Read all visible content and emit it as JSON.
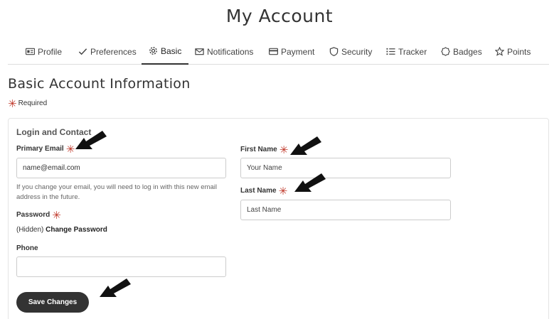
{
  "page": {
    "title": "My Account"
  },
  "tabs": [
    {
      "label": "Profile",
      "icon": "id-card-icon",
      "active": false
    },
    {
      "label": "Preferences",
      "icon": "checkmark-icon",
      "active": false
    },
    {
      "label": "Basic",
      "icon": "gear-icon",
      "active": true
    },
    {
      "label": "Notifications",
      "icon": "envelope-icon",
      "active": false
    },
    {
      "label": "Payment",
      "icon": "credit-card-icon",
      "active": false
    },
    {
      "label": "Security",
      "icon": "shield-icon",
      "active": false
    },
    {
      "label": "Tracker",
      "icon": "list-icon",
      "active": false
    },
    {
      "label": "Badges",
      "icon": "badge-icon",
      "active": false
    },
    {
      "label": "Points",
      "icon": "star-icon",
      "active": false
    }
  ],
  "section": {
    "title": "Basic Account Information",
    "required_note": "Required",
    "required_symbol": "✳"
  },
  "card": {
    "title": "Login and Contact",
    "primary_email": {
      "label": "Primary Email",
      "value": "name@email.com",
      "help": "If you change your email, you will need to log in with this new email address in the future."
    },
    "password": {
      "label": "Password",
      "hidden_text": "(Hidden)",
      "change_link": "Change Password"
    },
    "phone": {
      "label": "Phone",
      "value": ""
    },
    "first_name": {
      "label": "First Name",
      "placeholder": "Your Name"
    },
    "last_name": {
      "label": "Last Name",
      "placeholder": "Last Name"
    },
    "save_label": "Save Changes"
  },
  "colors": {
    "accent": "#333333",
    "required": "#c0392b"
  }
}
